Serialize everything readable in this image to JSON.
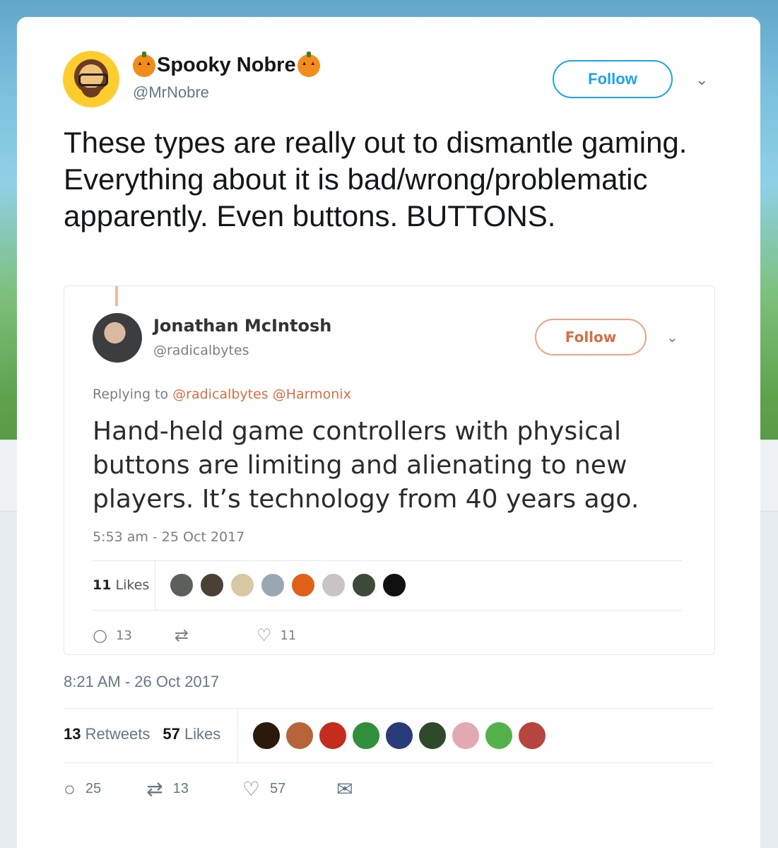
{
  "tweet": {
    "display_name": "Spooky Nobre",
    "handle": "@MrNobre",
    "follow_label": "Follow",
    "text": "These types are really out to dismantle gaming. Everything about it is bad/wrong/problematic apparently. Even buttons. BUTTONS.",
    "timestamp": "8:21 AM - 26 Oct 2017",
    "retweets_count": "13",
    "retweets_label": "Retweets",
    "likes_count": "57",
    "likes_label": "Likes",
    "actions": {
      "reply": "25",
      "retweet": "13",
      "like": "57"
    },
    "liker_colors": [
      "#2b1a0a",
      "#b8643a",
      "#c42c1e",
      "#2f8f3a",
      "#2a3b7a",
      "#2f4a2a",
      "#e3a9b2",
      "#55b24a",
      "#b5453e"
    ]
  },
  "quoted": {
    "display_name": "Jonathan McIntosh",
    "handle": "@radicalbytes",
    "follow_label": "Follow",
    "reply_prefix": "Replying to",
    "reply_mentions": "@radicalbytes @Harmonix",
    "text": "Hand-held game controllers with physical buttons are limiting and alienating to new players. It’s technology from 40 years ago.",
    "timestamp": "5:53 am - 25 Oct 2017",
    "likes_count": "11",
    "likes_label": "Likes",
    "actions": {
      "reply": "13",
      "like": "11"
    },
    "liker_colors": [
      "#5c5f5a",
      "#4a4036",
      "#d8c7a2",
      "#9aa7b3",
      "#e0601a",
      "#c9c3c6",
      "#3d4a3a",
      "#111111"
    ]
  },
  "icons": {
    "pumpkin": "pumpkin-icon",
    "chevron": "⌄",
    "reply": "○",
    "retweet": "⇄",
    "like": "♡",
    "dm": "✉"
  }
}
